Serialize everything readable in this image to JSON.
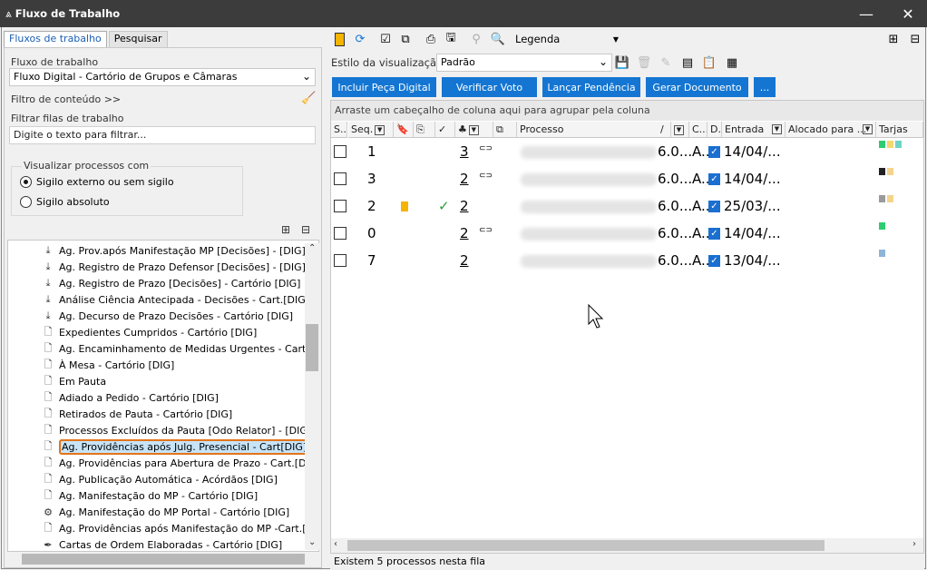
{
  "window": {
    "title": "Fluxo de Trabalho",
    "minimize": "—",
    "close": "✕"
  },
  "left": {
    "tabs": [
      "Fluxos de trabalho",
      "Pesquisar"
    ],
    "workflow_label": "Fluxo de trabalho",
    "workflow_value": "Fluxo Digital - Cartório de Grupos e Câmaras",
    "content_filter": "Filtro de conteúdo >>",
    "queue_filter_label": "Filtrar filas de trabalho",
    "queue_filter_placeholder": "Digite o texto para filtrar...",
    "view_group_label": "Visualizar processos com",
    "radio_external": "Sigilo externo ou sem sigilo",
    "radio_absolute": "Sigilo absoluto",
    "tree_items": [
      {
        "label": "Ag. Prov.após Manifestação MP [Decisões] - [DIG]",
        "icon": "arrow-down-icon"
      },
      {
        "label": "Ag. Registro de Prazo Defensor [Decisões] - [DIG]",
        "icon": "arrow-down-icon"
      },
      {
        "label": "Ag. Registro de Prazo [Decisões] - Cartório [DIG]",
        "icon": "arrow-down-icon"
      },
      {
        "label": "Análise Ciência Antecipada - Decisões - Cart.[DIG]",
        "icon": "arrow-down-icon"
      },
      {
        "label": "Ag. Decurso de Prazo Decisões - Cartório [DIG]",
        "icon": "arrow-down-icon"
      },
      {
        "label": "Expedientes Cumpridos - Cartório [DIG]",
        "icon": "document-icon"
      },
      {
        "label": "Ag. Encaminhamento de Medidas Urgentes - Cart [D]",
        "icon": "document-icon"
      },
      {
        "label": "À Mesa - Cartório [DIG]",
        "icon": "document-icon"
      },
      {
        "label": "Em Pauta",
        "icon": "document-icon"
      },
      {
        "label": "Adiado a Pedido - Cartório [DIG]",
        "icon": "document-icon"
      },
      {
        "label": "Retirados de Pauta - Cartório [DIG]",
        "icon": "document-icon"
      },
      {
        "label": "Processos Excluídos da Pauta [Odo Relator] - [DIG]",
        "icon": "document-icon"
      },
      {
        "label": "Ag. Providências após Julg. Presencial - Cart[DIG]",
        "icon": "document-icon"
      },
      {
        "label": "Ag. Providências para Abertura de Prazo - Cart.[D]",
        "icon": "document-icon"
      },
      {
        "label": "Ag. Publicação Automática - Acórdãos [DIG]",
        "icon": "document-icon"
      },
      {
        "label": "Ag. Manifestação do MP - Cartório [DIG]",
        "icon": "document-icon"
      },
      {
        "label": "Ag. Manifestação do MP Portal - Cartório [DIG]",
        "icon": "gear-document-icon"
      },
      {
        "label": "Ag. Providências após Manifestação do MP -Cart.[D]",
        "icon": "document-icon"
      },
      {
        "label": "Cartas de Ordem Elaboradas - Cartório [DIG]",
        "icon": "pen-icon"
      }
    ]
  },
  "right": {
    "legend_label": "Legenda",
    "view_style_label": "Estilo da visualização",
    "view_style_value": "Padrão",
    "actions": [
      "Incluir Peça Digital",
      "Verificar Voto",
      "Lançar Pendência",
      "Gerar Documento",
      "..."
    ],
    "group_hint": "Arraste um cabeçalho de coluna aqui para agrupar pela coluna",
    "columns": {
      "s": "S...",
      "seq": "Seq.",
      "processo": "Processo",
      "sort": "/",
      "c": "C...",
      "d": "D...",
      "entrada": "Entrada",
      "alocado": "Alocado para ...",
      "tarjas": "Tarjas"
    },
    "rows": [
      {
        "seq": "1",
        "count": "3",
        "ver": "6.0...",
        "a": "A...",
        "entrada": "14/04/...",
        "link": true,
        "bookmark": false,
        "check": false,
        "tarjas": [
          "#2ecc71",
          "#f5d76e",
          "#6fd3c7"
        ]
      },
      {
        "seq": "3",
        "count": "2",
        "ver": "6.0...",
        "a": "A...",
        "entrada": "14/04/...",
        "link": true,
        "bookmark": false,
        "check": false,
        "tarjas": [
          "#222222",
          "#f5d38a"
        ]
      },
      {
        "seq": "2",
        "count": "2",
        "ver": "6.0...",
        "a": "A...",
        "entrada": "25/03/...",
        "link": false,
        "bookmark": true,
        "check": true,
        "tarjas": [
          "#9a9a9a",
          "#f5d38a"
        ]
      },
      {
        "seq": "0",
        "count": "2",
        "ver": "6.0...",
        "a": "A...",
        "entrada": "14/04/...",
        "link": true,
        "bookmark": false,
        "check": false,
        "tarjas": [
          "#2ecc71"
        ]
      },
      {
        "seq": "7",
        "count": "2",
        "ver": "6.0...",
        "a": "A...",
        "entrada": "13/04/...",
        "link": false,
        "bookmark": false,
        "check": false,
        "tarjas": [
          "#8fb4d9"
        ]
      }
    ],
    "status": "Existem 5 processos nesta fila",
    "accent": "#1476d2",
    "selection_outline": "#e2741a"
  }
}
